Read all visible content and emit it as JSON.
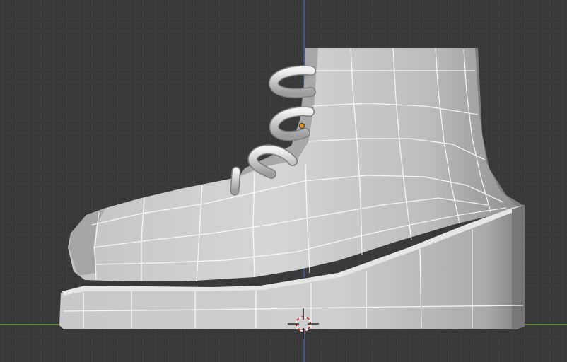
{
  "viewport": {
    "colors": {
      "background": "#393939",
      "grid_minor": "#434343",
      "grid_major": "#4a4a4a",
      "axis_x": "#6a9a3a",
      "axis_z": "#3d5fb0",
      "mesh_light": "#d2d2d2",
      "mesh_shadow": "#9a9a9a",
      "wire": "#ffffff",
      "cursor_red": "#d03030",
      "origin": "#e8962a"
    },
    "icons": {
      "cursor": "3d-cursor-icon",
      "origin": "object-origin-icon"
    }
  }
}
